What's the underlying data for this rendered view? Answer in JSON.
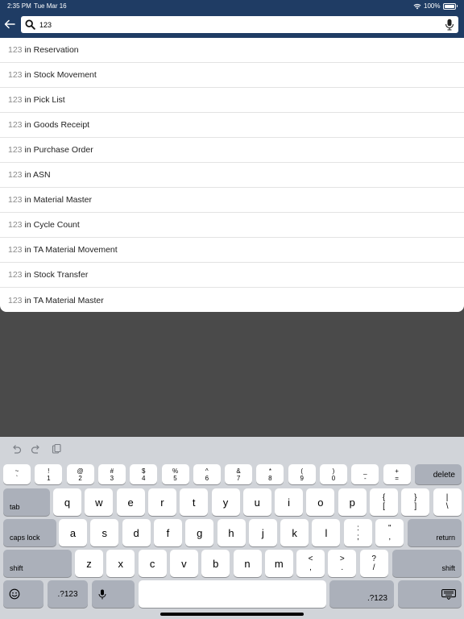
{
  "status": {
    "time": "2:35 PM",
    "date": "Tue Mar 16",
    "battery": "100%"
  },
  "search": {
    "value": "123"
  },
  "results": [
    {
      "query": "123",
      "suffix": "in Reservation"
    },
    {
      "query": "123",
      "suffix": "in Stock Movement"
    },
    {
      "query": "123",
      "suffix": "in Pick List"
    },
    {
      "query": "123",
      "suffix": "in Goods Receipt"
    },
    {
      "query": "123",
      "suffix": "in Purchase Order"
    },
    {
      "query": "123",
      "suffix": "in ASN"
    },
    {
      "query": "123",
      "suffix": "in Material Master"
    },
    {
      "query": "123",
      "suffix": "in Cycle Count"
    },
    {
      "query": "123",
      "suffix": "in TA Material Movement"
    },
    {
      "query": "123",
      "suffix": "in Stock Transfer"
    },
    {
      "query": "123",
      "suffix": "in TA Material Master"
    }
  ],
  "keyboard": {
    "num_row": [
      [
        "~",
        "`"
      ],
      [
        "!",
        "1"
      ],
      [
        "@",
        "2"
      ],
      [
        "#",
        "3"
      ],
      [
        "$",
        "4"
      ],
      [
        "%",
        "5"
      ],
      [
        "^",
        "6"
      ],
      [
        "&",
        "7"
      ],
      [
        "*",
        "8"
      ],
      [
        "(",
        "9"
      ],
      [
        ")",
        "0"
      ],
      [
        "_",
        "-"
      ],
      [
        "+",
        "="
      ]
    ],
    "delete": "delete",
    "tab": "tab",
    "row1": [
      "q",
      "w",
      "e",
      "r",
      "t",
      "y",
      "u",
      "i",
      "o",
      "p"
    ],
    "row1_syms": [
      [
        "{",
        "["
      ],
      [
        "}",
        "]"
      ],
      [
        "|",
        "\\"
      ]
    ],
    "caps_lock": "caps lock",
    "row2": [
      "a",
      "s",
      "d",
      "f",
      "g",
      "h",
      "j",
      "k",
      "l"
    ],
    "row2_syms": [
      [
        ":",
        ";"
      ],
      [
        "\"",
        ","
      ]
    ],
    "return": "return",
    "shift": "shift",
    "row3": [
      "z",
      "x",
      "c",
      "v",
      "b",
      "n",
      "m"
    ],
    "row3_syms": [
      [
        "<",
        ","
      ],
      [
        ">",
        "."
      ],
      [
        "?",
        "/"
      ]
    ],
    "numeric_toggle": ".?123",
    "emoji_icon": "emoji-icon",
    "mic_icon": "microphone-icon",
    "hide_keyboard_icon": "keyboard-hide-icon"
  },
  "colors": {
    "header": "#1f3c64",
    "keyboard_bg": "#d1d4d9",
    "dim_overlay": "#4a4a4a"
  }
}
